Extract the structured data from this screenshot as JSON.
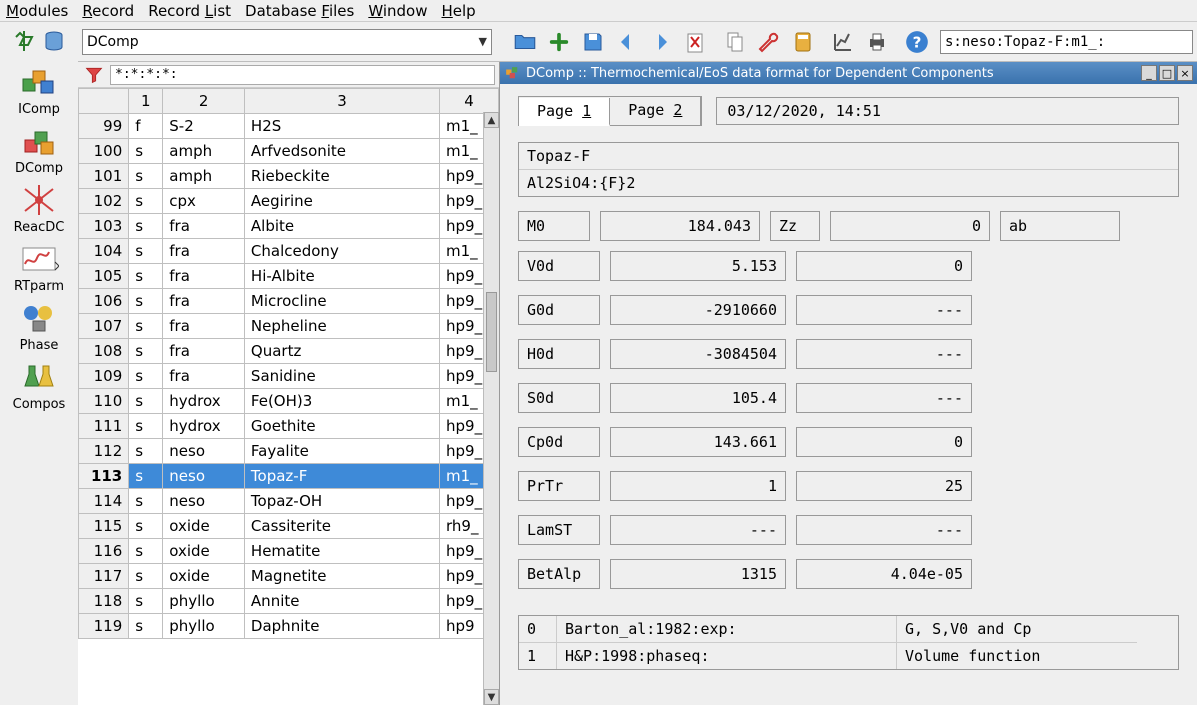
{
  "menubar": [
    "Modules",
    "Record",
    "Record List",
    "Database Files",
    "Window",
    "Help"
  ],
  "menubar_u": [
    "M",
    "R",
    "L",
    "F",
    "W",
    "H"
  ],
  "left_modules": [
    {
      "id": "icomp",
      "label": "IComp"
    },
    {
      "id": "dcomp",
      "label": "DComp"
    },
    {
      "id": "reacdc",
      "label": "ReacDC"
    },
    {
      "id": "rtparm",
      "label": "RTparm"
    },
    {
      "id": "phase",
      "label": "Phase"
    },
    {
      "id": "compos",
      "label": "Compos"
    }
  ],
  "combo_value": "DComp",
  "search_value": "s:neso:Topaz-F:m1_:",
  "filter_text": "*:*:*:*:",
  "columns": [
    "1",
    "2",
    "3",
    "4"
  ],
  "rows": [
    {
      "n": "99",
      "c": [
        "f",
        "S-2",
        "H2S",
        "m1_"
      ],
      "sel": false
    },
    {
      "n": "100",
      "c": [
        "s",
        "amph",
        "Arfvedsonite",
        "m1_"
      ],
      "sel": false
    },
    {
      "n": "101",
      "c": [
        "s",
        "amph",
        "Riebeckite",
        "hp9_"
      ],
      "sel": false
    },
    {
      "n": "102",
      "c": [
        "s",
        "cpx",
        "Aegirine",
        "hp9_"
      ],
      "sel": false
    },
    {
      "n": "103",
      "c": [
        "s",
        "fra",
        "Albite",
        "hp9_"
      ],
      "sel": false
    },
    {
      "n": "104",
      "c": [
        "s",
        "fra",
        "Chalcedony",
        "m1_"
      ],
      "sel": false
    },
    {
      "n": "105",
      "c": [
        "s",
        "fra",
        "Hi-Albite",
        "hp9_"
      ],
      "sel": false
    },
    {
      "n": "106",
      "c": [
        "s",
        "fra",
        "Microcline",
        "hp9_"
      ],
      "sel": false
    },
    {
      "n": "107",
      "c": [
        "s",
        "fra",
        "Nepheline",
        "hp9_"
      ],
      "sel": false
    },
    {
      "n": "108",
      "c": [
        "s",
        "fra",
        "Quartz",
        "hp9_"
      ],
      "sel": false
    },
    {
      "n": "109",
      "c": [
        "s",
        "fra",
        "Sanidine",
        "hp9_"
      ],
      "sel": false
    },
    {
      "n": "110",
      "c": [
        "s",
        "hydrox",
        "Fe(OH)3",
        "m1_"
      ],
      "sel": false
    },
    {
      "n": "111",
      "c": [
        "s",
        "hydrox",
        "Goethite",
        "hp9_"
      ],
      "sel": false
    },
    {
      "n": "112",
      "c": [
        "s",
        "neso",
        "Fayalite",
        "hp9_"
      ],
      "sel": false
    },
    {
      "n": "113",
      "c": [
        "s",
        "neso",
        "Topaz-F",
        "m1_"
      ],
      "sel": true
    },
    {
      "n": "114",
      "c": [
        "s",
        "neso",
        "Topaz-OH",
        "hp9_"
      ],
      "sel": false
    },
    {
      "n": "115",
      "c": [
        "s",
        "oxide",
        "Cassiterite",
        "rh9_"
      ],
      "sel": false
    },
    {
      "n": "116",
      "c": [
        "s",
        "oxide",
        "Hematite",
        "hp9_"
      ],
      "sel": false
    },
    {
      "n": "117",
      "c": [
        "s",
        "oxide",
        "Magnetite",
        "hp9_"
      ],
      "sel": false
    },
    {
      "n": "118",
      "c": [
        "s",
        "phyllo",
        "Annite",
        "hp9_"
      ],
      "sel": false
    },
    {
      "n": "119",
      "c": [
        "s",
        "phyllo",
        "Daphnite",
        "hp9"
      ],
      "sel": false
    }
  ],
  "subwindow_title": "DComp ::  Thermochemical/EoS data format for Dependent Components",
  "tabs": [
    {
      "label": "Page 1",
      "active": true,
      "u": "1"
    },
    {
      "label": "Page 2",
      "active": false,
      "u": "2"
    }
  ],
  "date": "03/12/2020, 14:51",
  "name_lines": [
    "Topaz-F",
    "Al2SiO4:{F}2"
  ],
  "triple": {
    "l1": "M0",
    "v1": "184.043",
    "l2": "Zz",
    "v2": "0",
    "unit": "ab"
  },
  "props": [
    {
      "label": "V0d",
      "v1": "5.153",
      "v2": "0"
    },
    {
      "label": "G0d",
      "v1": "-2910660",
      "v2": "---"
    },
    {
      "label": "H0d",
      "v1": "-3084504",
      "v2": "---"
    },
    {
      "label": "S0d",
      "v1": "105.4",
      "v2": "---"
    },
    {
      "label": "Cp0d",
      "v1": "143.661",
      "v2": "0"
    },
    {
      "label": "PrTr",
      "v1": "1",
      "v2": "25"
    },
    {
      "label": "LamST",
      "v1": "---",
      "v2": "---"
    },
    {
      "label": "BetAlp",
      "v1": "1315",
      "v2": "4.04e-05"
    }
  ],
  "refs": [
    {
      "idx": "0",
      "ref": "Barton_al:1982:exp:",
      "note": "G, S,V0 and Cp"
    },
    {
      "idx": "1",
      "ref": "H&P:1998:phaseq:",
      "note": "Volume function"
    }
  ]
}
